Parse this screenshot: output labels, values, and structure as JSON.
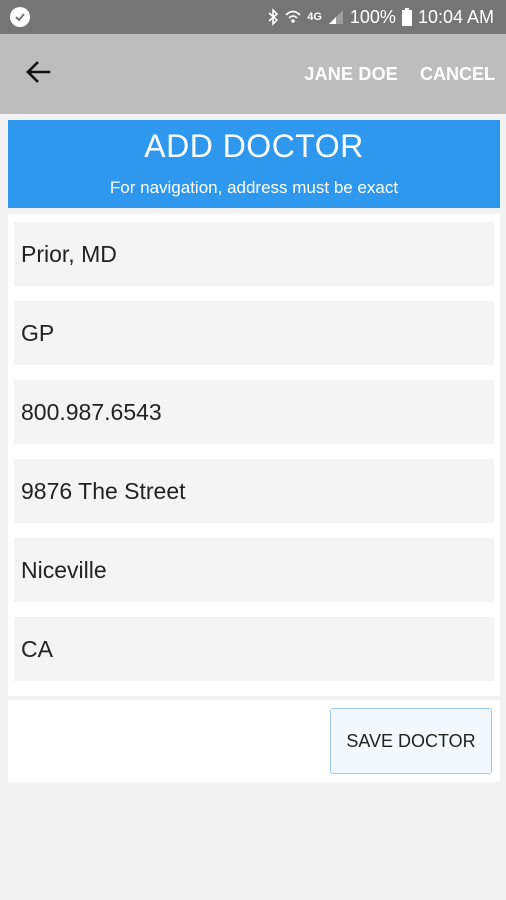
{
  "status_bar": {
    "battery_percent": "100%",
    "time": "10:04 AM",
    "network": "4G",
    "icons": [
      "check-circle-icon",
      "bluetooth-icon",
      "wifi-icon",
      "network-4g-icon",
      "signal-icon",
      "battery-icon"
    ]
  },
  "toolbar": {
    "back_icon": "arrow-left-icon",
    "user_name": "JANE DOE",
    "cancel_label": "CANCEL"
  },
  "header": {
    "title": "ADD DOCTOR",
    "subtitle": "For navigation, address must be exact"
  },
  "form": {
    "fields": [
      {
        "value": "Prior, MD"
      },
      {
        "value": "GP"
      },
      {
        "value": "800.987.6543"
      },
      {
        "value": "9876 The Street"
      },
      {
        "value": "Niceville"
      },
      {
        "value": "CA"
      }
    ]
  },
  "actions": {
    "save_label": "SAVE DOCTOR"
  },
  "colors": {
    "status_bar": "#757575",
    "toolbar": "#bdbdbd",
    "header": "#2d98ee",
    "field_bg": "#f4f4f4",
    "save_border": "#9ccaf0"
  }
}
